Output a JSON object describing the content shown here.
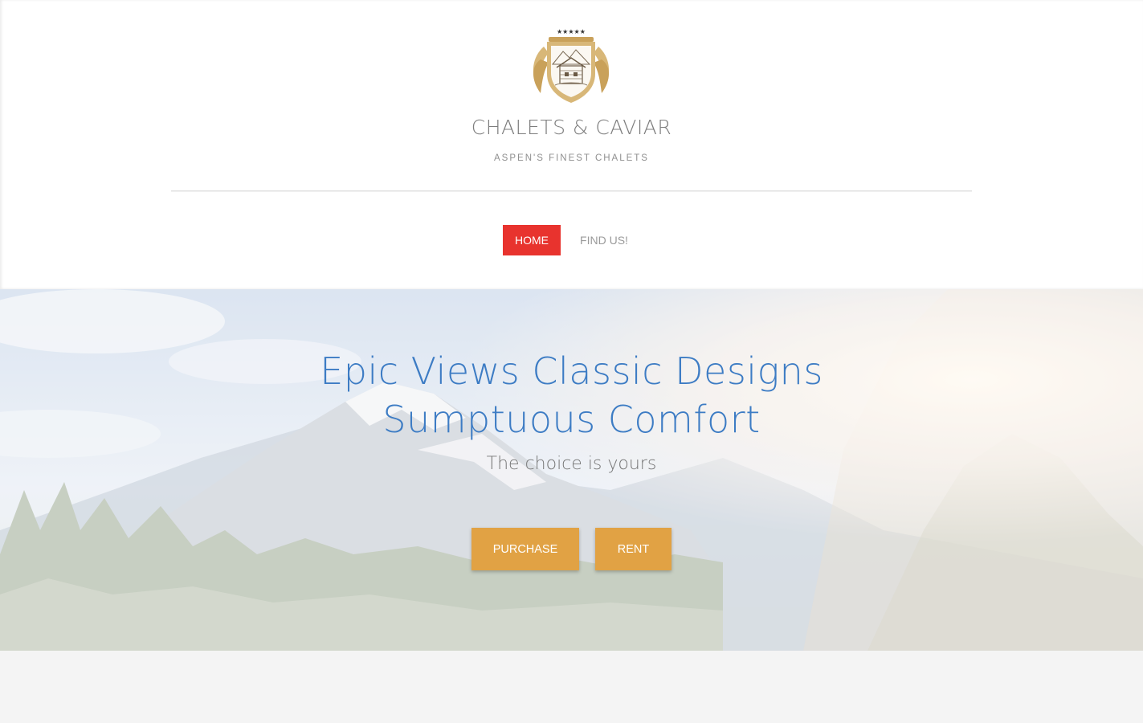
{
  "site": {
    "title": "CHALETS & CAVIAR",
    "tagline": "ASPEN'S FINEST CHALETS",
    "logo_icon": "crest-logo-icon"
  },
  "nav": {
    "items": [
      {
        "label": "HOME",
        "active": true
      },
      {
        "label": "FIND US!",
        "active": false
      }
    ]
  },
  "hero": {
    "title": "Epic Views Classic Designs Sumptuous Comfort",
    "subtitle": "The choice is yours",
    "buttons": [
      {
        "label": "PURCHASE"
      },
      {
        "label": "RENT"
      }
    ]
  },
  "colors": {
    "accent": "#e8332e",
    "button": "#e1a244",
    "headline": "#3d7cc4",
    "logo_gold": "#c9a15a"
  }
}
